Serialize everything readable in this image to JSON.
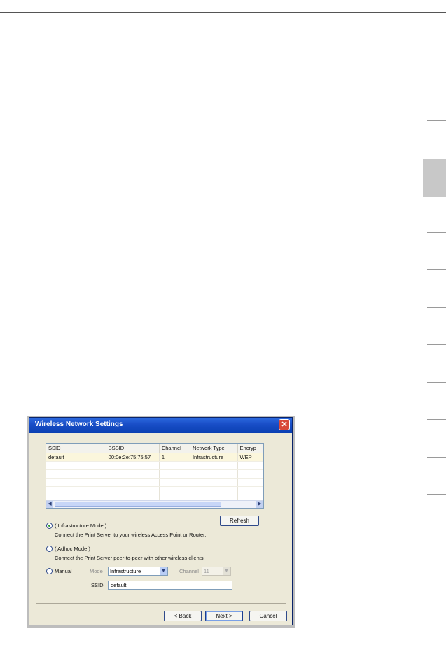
{
  "dialog": {
    "title": "Wireless Network Settings",
    "close_glyph": "✕",
    "network_list": {
      "columns": [
        "SSID",
        "BSSID",
        "Channel",
        "Network Type",
        "Encryp"
      ],
      "rows": [
        [
          "default",
          "00:0e:2e:75:75:57",
          "1",
          "Infrastructure",
          "WEP"
        ]
      ],
      "empty_row_count": 5
    },
    "refresh_label": "Refresh",
    "infrastructure": {
      "label": "( Infrastructure Mode )",
      "description": "Connect the Print Server to your wireless Access Point or Router."
    },
    "adhoc": {
      "label": "( Adhoc Mode )",
      "description": "Connect the Print Server peer-to-peer with other wireless clients."
    },
    "manual": {
      "label": "Manual",
      "mode_label": "Mode",
      "mode_value": "Infrastructure",
      "channel_label": "Channel",
      "channel_value": "11",
      "ssid_label": "SSID",
      "ssid_value": "default"
    },
    "back_label": "< Back",
    "next_label": "Next >",
    "cancel_label": "Cancel"
  }
}
